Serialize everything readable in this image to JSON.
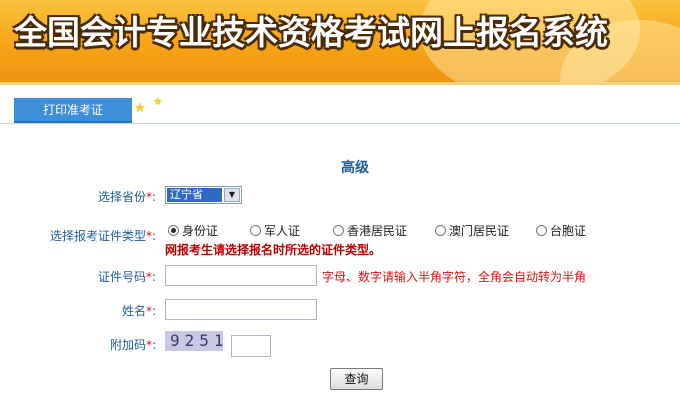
{
  "banner": {
    "title": "全国会计专业技术资格考试网上报名系统"
  },
  "nav": {
    "tab_label": "打印准考证"
  },
  "form": {
    "heading": "高级",
    "required_mark": "*",
    "province": {
      "label": "选择省份",
      "value": "辽宁省"
    },
    "id_type": {
      "label": "选择报考证件类型",
      "options": [
        "身份证",
        "军人证",
        "香港居民证",
        "澳门居民证",
        "台胞证"
      ],
      "selected": "身份证",
      "note": "网报考生请选择报名时所选的证件类型。"
    },
    "id_number": {
      "label": "证件号码",
      "value": "",
      "hint": "字母、数字请输入半角字符，全角会自动转为半角"
    },
    "name": {
      "label": "姓名",
      "value": ""
    },
    "captcha": {
      "label": "附加码",
      "image_text": "9251",
      "value": ""
    },
    "submit_label": "查询"
  },
  "colors": {
    "banner": "#f6a417",
    "tab": "#3d8fd9",
    "label": "#1f5e96",
    "warning": "#c00000"
  }
}
